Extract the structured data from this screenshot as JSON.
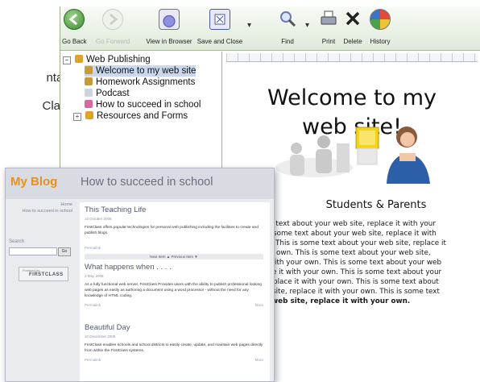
{
  "background": {
    "line1": "ntain",
    "line2": "Class"
  },
  "toolbar": {
    "go_back": "Go Back",
    "go_forward": "Go Forward",
    "view_in_browser": "View in Browser",
    "save_and_close": "Save and Close",
    "find": "Find",
    "print": "Print",
    "delete": "Delete",
    "history": "History"
  },
  "tree": {
    "root": "Web Publishing",
    "items": [
      "Welcome to my web site",
      "Homework Assignments",
      "Podcast",
      "How to succeed in school",
      "Resources and Forms"
    ]
  },
  "preview": {
    "welcome_line1": "Welcome to my",
    "welcome_line2": "web site!",
    "section_title": "Students & Parents",
    "lines": [
      "n text about your web site, replace it with your",
      "some text about your web site, replace it with",
      "This is some text about your web site, replace it",
      "own. This is some text about your web site,",
      "ith your own. This is some text about your web",
      "e it with your own. This is some text about your",
      "place it with your own. This is some text about",
      "site, replace it with your own. This is some text",
      "web site, replace it with your own."
    ]
  },
  "blog": {
    "title": "My Blog",
    "post_heading": "How to succeed in school",
    "side_home": "Home",
    "side_crumb": "How to succeed in school",
    "search_label": "Search",
    "go": "Go",
    "logo_powered": "Powered by",
    "logo_name": "FIRSTCLASS",
    "posts": [
      {
        "title": "This Teaching Life",
        "date": "10 October 2008",
        "body": "FirstClass offers popular technologies for personal web publishing including the facilities to create and publish blogs.",
        "link": "Permalink",
        "pager": "Next Item ▲    Previous Item ▼"
      },
      {
        "title": "What happens when . . . .",
        "date": "2 May 2008",
        "body": "As a fully functional web server, FirstClass Provides users with the ability to publish professional looking web pages as easily as authoring a document using a word processor - without the need for any knowledge of HTML coding.",
        "link": "Permalink",
        "more": "More"
      },
      {
        "title": "Beautiful Day",
        "date": "10 December 2008",
        "body": "FirstClass enables schools and school districts to easily create, update, and maintain web pages directly from within the FirstClass systems.",
        "link": "Permalink",
        "more": "More"
      }
    ]
  }
}
